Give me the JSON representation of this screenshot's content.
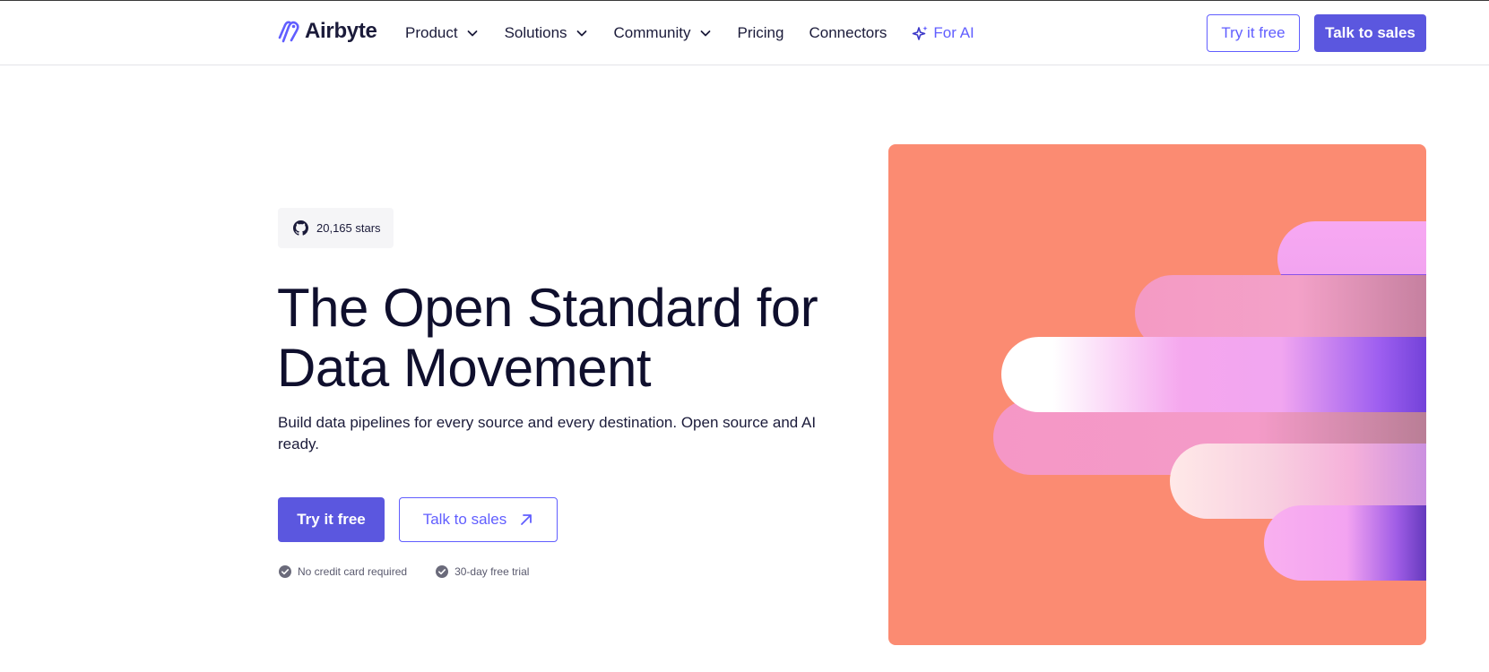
{
  "header": {
    "logo_text": "Airbyte",
    "nav": [
      {
        "label": "Product",
        "has_dropdown": true
      },
      {
        "label": "Solutions",
        "has_dropdown": true
      },
      {
        "label": "Community",
        "has_dropdown": true
      },
      {
        "label": "Pricing",
        "has_dropdown": false
      },
      {
        "label": "Connectors",
        "has_dropdown": false
      },
      {
        "label": "For AI",
        "icon": "sparkle-icon"
      }
    ],
    "try_label": "Try it free",
    "sales_label": "Talk to sales"
  },
  "hero": {
    "stars_label": "20,165 stars",
    "title_line1": "The Open Standard for",
    "title_line2": "Data Movement",
    "subtitle": "Build data pipelines for every source and every destination. Open source and AI ready.",
    "cta_try": "Try it free",
    "cta_sales": "Talk to sales",
    "perks": [
      "No credit card required",
      "30-day free trial"
    ]
  },
  "colors": {
    "brand": "#615eff",
    "brand_button": "#5b57df",
    "art_background": "#fb8b72",
    "text_dark": "#0f0f2d"
  }
}
